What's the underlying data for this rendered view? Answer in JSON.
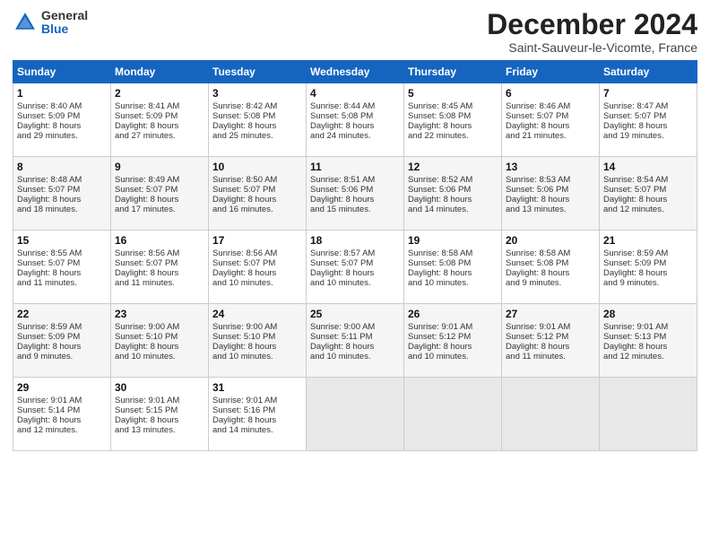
{
  "header": {
    "logo_general": "General",
    "logo_blue": "Blue",
    "month": "December 2024",
    "location": "Saint-Sauveur-le-Vicomte, France"
  },
  "weekdays": [
    "Sunday",
    "Monday",
    "Tuesday",
    "Wednesday",
    "Thursday",
    "Friday",
    "Saturday"
  ],
  "weeks": [
    [
      {
        "day": "1",
        "lines": [
          "Sunrise: 8:40 AM",
          "Sunset: 5:09 PM",
          "Daylight: 8 hours",
          "and 29 minutes."
        ]
      },
      {
        "day": "2",
        "lines": [
          "Sunrise: 8:41 AM",
          "Sunset: 5:09 PM",
          "Daylight: 8 hours",
          "and 27 minutes."
        ]
      },
      {
        "day": "3",
        "lines": [
          "Sunrise: 8:42 AM",
          "Sunset: 5:08 PM",
          "Daylight: 8 hours",
          "and 25 minutes."
        ]
      },
      {
        "day": "4",
        "lines": [
          "Sunrise: 8:44 AM",
          "Sunset: 5:08 PM",
          "Daylight: 8 hours",
          "and 24 minutes."
        ]
      },
      {
        "day": "5",
        "lines": [
          "Sunrise: 8:45 AM",
          "Sunset: 5:08 PM",
          "Daylight: 8 hours",
          "and 22 minutes."
        ]
      },
      {
        "day": "6",
        "lines": [
          "Sunrise: 8:46 AM",
          "Sunset: 5:07 PM",
          "Daylight: 8 hours",
          "and 21 minutes."
        ]
      },
      {
        "day": "7",
        "lines": [
          "Sunrise: 8:47 AM",
          "Sunset: 5:07 PM",
          "Daylight: 8 hours",
          "and 19 minutes."
        ]
      }
    ],
    [
      {
        "day": "8",
        "lines": [
          "Sunrise: 8:48 AM",
          "Sunset: 5:07 PM",
          "Daylight: 8 hours",
          "and 18 minutes."
        ]
      },
      {
        "day": "9",
        "lines": [
          "Sunrise: 8:49 AM",
          "Sunset: 5:07 PM",
          "Daylight: 8 hours",
          "and 17 minutes."
        ]
      },
      {
        "day": "10",
        "lines": [
          "Sunrise: 8:50 AM",
          "Sunset: 5:07 PM",
          "Daylight: 8 hours",
          "and 16 minutes."
        ]
      },
      {
        "day": "11",
        "lines": [
          "Sunrise: 8:51 AM",
          "Sunset: 5:06 PM",
          "Daylight: 8 hours",
          "and 15 minutes."
        ]
      },
      {
        "day": "12",
        "lines": [
          "Sunrise: 8:52 AM",
          "Sunset: 5:06 PM",
          "Daylight: 8 hours",
          "and 14 minutes."
        ]
      },
      {
        "day": "13",
        "lines": [
          "Sunrise: 8:53 AM",
          "Sunset: 5:06 PM",
          "Daylight: 8 hours",
          "and 13 minutes."
        ]
      },
      {
        "day": "14",
        "lines": [
          "Sunrise: 8:54 AM",
          "Sunset: 5:07 PM",
          "Daylight: 8 hours",
          "and 12 minutes."
        ]
      }
    ],
    [
      {
        "day": "15",
        "lines": [
          "Sunrise: 8:55 AM",
          "Sunset: 5:07 PM",
          "Daylight: 8 hours",
          "and 11 minutes."
        ]
      },
      {
        "day": "16",
        "lines": [
          "Sunrise: 8:56 AM",
          "Sunset: 5:07 PM",
          "Daylight: 8 hours",
          "and 11 minutes."
        ]
      },
      {
        "day": "17",
        "lines": [
          "Sunrise: 8:56 AM",
          "Sunset: 5:07 PM",
          "Daylight: 8 hours",
          "and 10 minutes."
        ]
      },
      {
        "day": "18",
        "lines": [
          "Sunrise: 8:57 AM",
          "Sunset: 5:07 PM",
          "Daylight: 8 hours",
          "and 10 minutes."
        ]
      },
      {
        "day": "19",
        "lines": [
          "Sunrise: 8:58 AM",
          "Sunset: 5:08 PM",
          "Daylight: 8 hours",
          "and 10 minutes."
        ]
      },
      {
        "day": "20",
        "lines": [
          "Sunrise: 8:58 AM",
          "Sunset: 5:08 PM",
          "Daylight: 8 hours",
          "and 9 minutes."
        ]
      },
      {
        "day": "21",
        "lines": [
          "Sunrise: 8:59 AM",
          "Sunset: 5:09 PM",
          "Daylight: 8 hours",
          "and 9 minutes."
        ]
      }
    ],
    [
      {
        "day": "22",
        "lines": [
          "Sunrise: 8:59 AM",
          "Sunset: 5:09 PM",
          "Daylight: 8 hours",
          "and 9 minutes."
        ]
      },
      {
        "day": "23",
        "lines": [
          "Sunrise: 9:00 AM",
          "Sunset: 5:10 PM",
          "Daylight: 8 hours",
          "and 10 minutes."
        ]
      },
      {
        "day": "24",
        "lines": [
          "Sunrise: 9:00 AM",
          "Sunset: 5:10 PM",
          "Daylight: 8 hours",
          "and 10 minutes."
        ]
      },
      {
        "day": "25",
        "lines": [
          "Sunrise: 9:00 AM",
          "Sunset: 5:11 PM",
          "Daylight: 8 hours",
          "and 10 minutes."
        ]
      },
      {
        "day": "26",
        "lines": [
          "Sunrise: 9:01 AM",
          "Sunset: 5:12 PM",
          "Daylight: 8 hours",
          "and 10 minutes."
        ]
      },
      {
        "day": "27",
        "lines": [
          "Sunrise: 9:01 AM",
          "Sunset: 5:12 PM",
          "Daylight: 8 hours",
          "and 11 minutes."
        ]
      },
      {
        "day": "28",
        "lines": [
          "Sunrise: 9:01 AM",
          "Sunset: 5:13 PM",
          "Daylight: 8 hours",
          "and 12 minutes."
        ]
      }
    ],
    [
      {
        "day": "29",
        "lines": [
          "Sunrise: 9:01 AM",
          "Sunset: 5:14 PM",
          "Daylight: 8 hours",
          "and 12 minutes."
        ]
      },
      {
        "day": "30",
        "lines": [
          "Sunrise: 9:01 AM",
          "Sunset: 5:15 PM",
          "Daylight: 8 hours",
          "and 13 minutes."
        ]
      },
      {
        "day": "31",
        "lines": [
          "Sunrise: 9:01 AM",
          "Sunset: 5:16 PM",
          "Daylight: 8 hours",
          "and 14 minutes."
        ]
      },
      {
        "day": "",
        "lines": []
      },
      {
        "day": "",
        "lines": []
      },
      {
        "day": "",
        "lines": []
      },
      {
        "day": "",
        "lines": []
      }
    ]
  ]
}
